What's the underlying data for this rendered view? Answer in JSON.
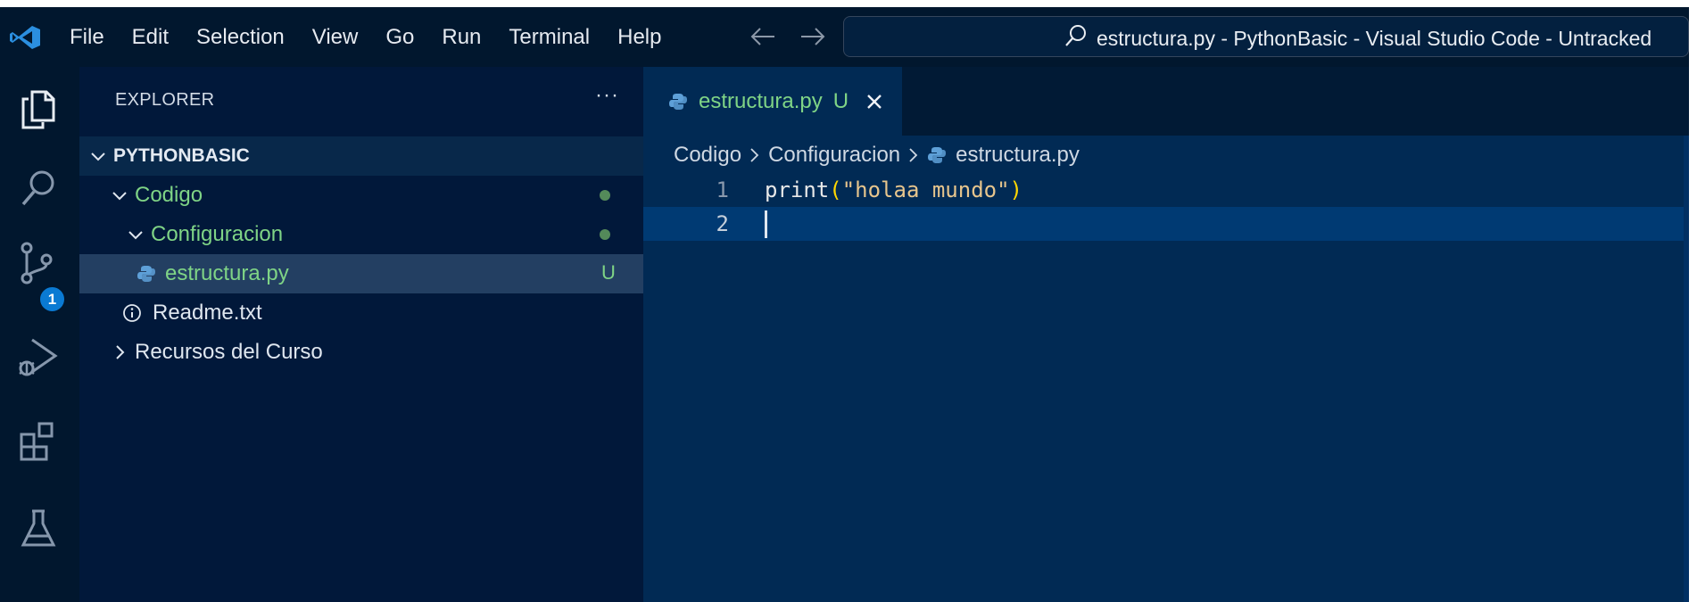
{
  "window": {
    "title": "estructura.py - PythonBasic - Visual Studio Code - Untracked"
  },
  "menu": {
    "items": [
      "File",
      "Edit",
      "Selection",
      "View",
      "Go",
      "Run",
      "Terminal",
      "Help"
    ]
  },
  "activity_bar": {
    "icons": [
      "explorer-icon",
      "search-icon",
      "source-control-icon",
      "run-debug-icon",
      "extensions-icon",
      "testing-icon"
    ],
    "source_control_badge": "1"
  },
  "sidebar": {
    "header": "EXPLORER",
    "more": "···",
    "root": "PYTHONBASIC",
    "tree": {
      "codigo": "Codigo",
      "configuracion": "Configuracion",
      "estructura": "estructura.py",
      "estructura_status": "U",
      "readme": "Readme.txt",
      "recursos": "Recursos del Curso"
    }
  },
  "editor": {
    "tab": {
      "label": "estructura.py",
      "status": "U"
    },
    "breadcrumb": [
      "Codigo",
      "Configuracion",
      "estructura.py"
    ],
    "lines": [
      {
        "number": "1",
        "fn": "print",
        "open": "(",
        "str": "\"holaa mundo\"",
        "close": ")"
      },
      {
        "number": "2"
      }
    ]
  },
  "colors": {
    "editor_bg": "#012a54",
    "sidebar_bg": "#01183a",
    "titlebar_bg": "#01172e",
    "untracked_green": "#7fd486",
    "badge_blue": "#0a7ad3"
  }
}
